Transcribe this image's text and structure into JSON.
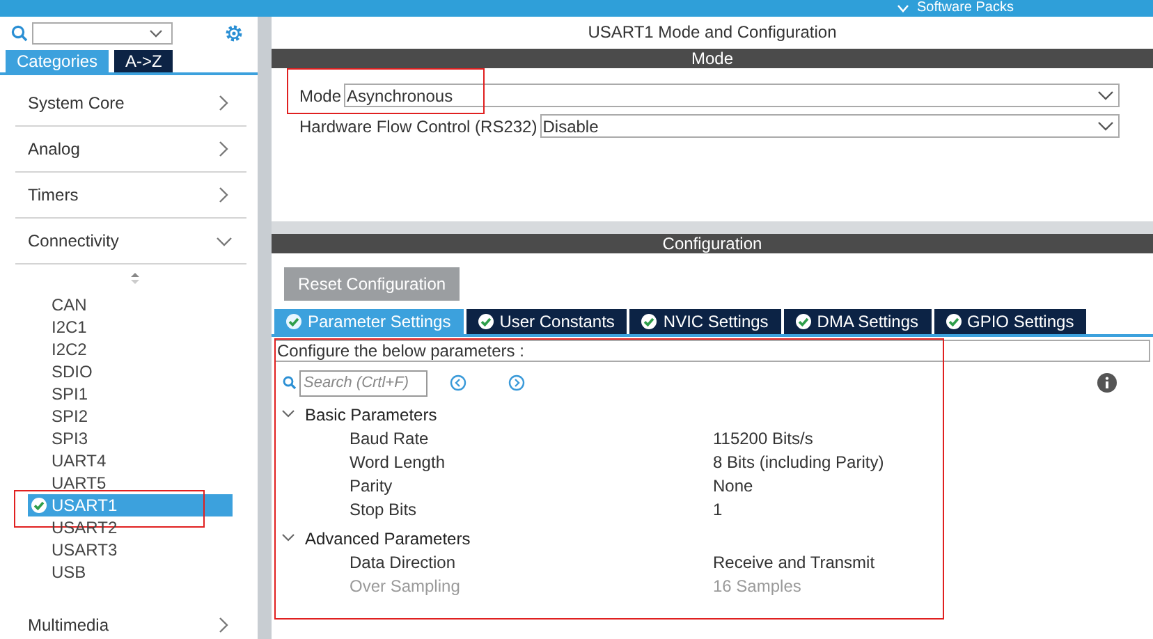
{
  "top_bar": {
    "title": "Software Packs"
  },
  "sidebar": {
    "tabs": [
      {
        "label": "Categories",
        "selected": true
      },
      {
        "label": "A->Z",
        "selected": false
      }
    ],
    "categories": [
      {
        "label": "System Core",
        "expanded": false
      },
      {
        "label": "Analog",
        "expanded": false
      },
      {
        "label": "Timers",
        "expanded": false
      },
      {
        "label": "Connectivity",
        "expanded": true,
        "children": [
          {
            "label": "CAN",
            "selected": false,
            "configured": false,
            "highlighted": false
          },
          {
            "label": "I2C1",
            "selected": false,
            "configured": false,
            "highlighted": false
          },
          {
            "label": "I2C2",
            "selected": false,
            "configured": false,
            "highlighted": false
          },
          {
            "label": "SDIO",
            "selected": false,
            "configured": false,
            "highlighted": false
          },
          {
            "label": "SPI1",
            "selected": false,
            "configured": false,
            "highlighted": false
          },
          {
            "label": "SPI2",
            "selected": false,
            "configured": false,
            "highlighted": false
          },
          {
            "label": "SPI3",
            "selected": false,
            "configured": false,
            "highlighted": false
          },
          {
            "label": "UART4",
            "selected": false,
            "configured": false,
            "highlighted": false
          },
          {
            "label": "UART5",
            "selected": false,
            "configured": false,
            "highlighted": false
          },
          {
            "label": "USART1",
            "selected": true,
            "configured": true,
            "highlighted": true
          },
          {
            "label": "USART2",
            "selected": false,
            "configured": false,
            "highlighted": false
          },
          {
            "label": "USART3",
            "selected": false,
            "configured": false,
            "highlighted": false
          },
          {
            "label": "USB",
            "selected": false,
            "configured": false,
            "highlighted": false
          }
        ]
      },
      {
        "label": "Multimedia",
        "expanded": false
      }
    ]
  },
  "main": {
    "title": "USART1 Mode and Configuration",
    "mode": {
      "header": "Mode",
      "fields": [
        {
          "label": "Mode",
          "value": "Asynchronous",
          "highlighted": true
        },
        {
          "label": "Hardware Flow Control (RS232)",
          "value": "Disable",
          "highlighted": false
        }
      ]
    },
    "configuration": {
      "header": "Configuration",
      "reset_button": "Reset Configuration",
      "tabs": [
        {
          "label": "Parameter Settings",
          "selected": true
        },
        {
          "label": "User Constants",
          "selected": false
        },
        {
          "label": "NVIC Settings",
          "selected": false
        },
        {
          "label": "DMA Settings",
          "selected": false
        },
        {
          "label": "GPIO Settings",
          "selected": false
        }
      ],
      "parameters": {
        "highlighted": true,
        "hint": "Configure the below parameters :",
        "search": {
          "placeholder": "Search (Crtl+F)"
        },
        "groups": [
          {
            "label": "Basic Parameters",
            "expanded": true,
            "children": [
              {
                "name": "Baud Rate",
                "value": "115200 Bits/s",
                "disabled": false
              },
              {
                "name": "Word Length",
                "value": "8 Bits (including Parity)",
                "disabled": false
              },
              {
                "name": "Parity",
                "value": "None",
                "disabled": false
              },
              {
                "name": "Stop Bits",
                "value": "1",
                "disabled": false
              }
            ]
          },
          {
            "label": "Advanced Parameters",
            "expanded": true,
            "children": [
              {
                "name": "Data Direction",
                "value": "Receive and Transmit",
                "disabled": false
              },
              {
                "name": "Over Sampling",
                "value": "16 Samples",
                "disabled": true
              }
            ]
          }
        ]
      }
    }
  }
}
